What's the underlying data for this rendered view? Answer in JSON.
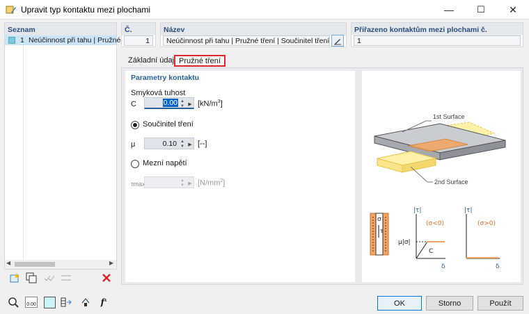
{
  "window": {
    "title": "Upravit typ kontaktu mezi plochami",
    "minimize": "—",
    "maximize": "☐",
    "close": "✕"
  },
  "list": {
    "header": "Seznam",
    "items": [
      {
        "number": "1",
        "label": "Neúčinnost při tahu | Pružné tře"
      }
    ]
  },
  "number_field": {
    "header": "Č.",
    "value": "1"
  },
  "name_field": {
    "header": "Název",
    "value": "Neúčinnost při tahu | Pružné tření | Součinitel tření (Kont"
  },
  "assigned_field": {
    "header": "Přiřazeno kontaktům mezi plochami č.",
    "value": "1"
  },
  "tabs": [
    {
      "label": "Základní údaje"
    },
    {
      "label": "Pružné tření"
    }
  ],
  "params": {
    "section_title": "Parametry kontaktu",
    "shear_stiffness_label": "Smyková tuhost",
    "c_symbol": "C",
    "c_value": "0.00",
    "c_unit_base": "[kN/m",
    "c_unit_sup": "3",
    "c_unit_end": "]",
    "friction_option": "Součinitel tření",
    "mu_symbol": "μ",
    "mu_value": "0.10",
    "mu_unit": "[--]",
    "limit_option": "Mezní napětí",
    "tau_symbol": "τmax",
    "tau_value": "",
    "tau_unit_base": "[N/mm",
    "tau_unit_sup": "2",
    "tau_unit_end": "]"
  },
  "diagram": {
    "surface1": "1st Surface",
    "surface2": "2nd Surface",
    "sigma": "σ",
    "tau": "τ",
    "tau_abs": "|τ|",
    "sigma_neg": "(σ<0)",
    "sigma_pos": "(σ>0)",
    "mu_sigma": "μ|σ|",
    "c_label": "C",
    "delta": "δ"
  },
  "buttons": {
    "ok": "OK",
    "cancel": "Storno",
    "apply": "Použít",
    "value_display": "0.00"
  },
  "colors": {
    "highlight_red": "#e0262b",
    "accent_blue": "#2a6099",
    "surface_orange": "#f4a460",
    "surface_yellow": "#fff2a8",
    "plate_grey": "#b9bdc2"
  }
}
